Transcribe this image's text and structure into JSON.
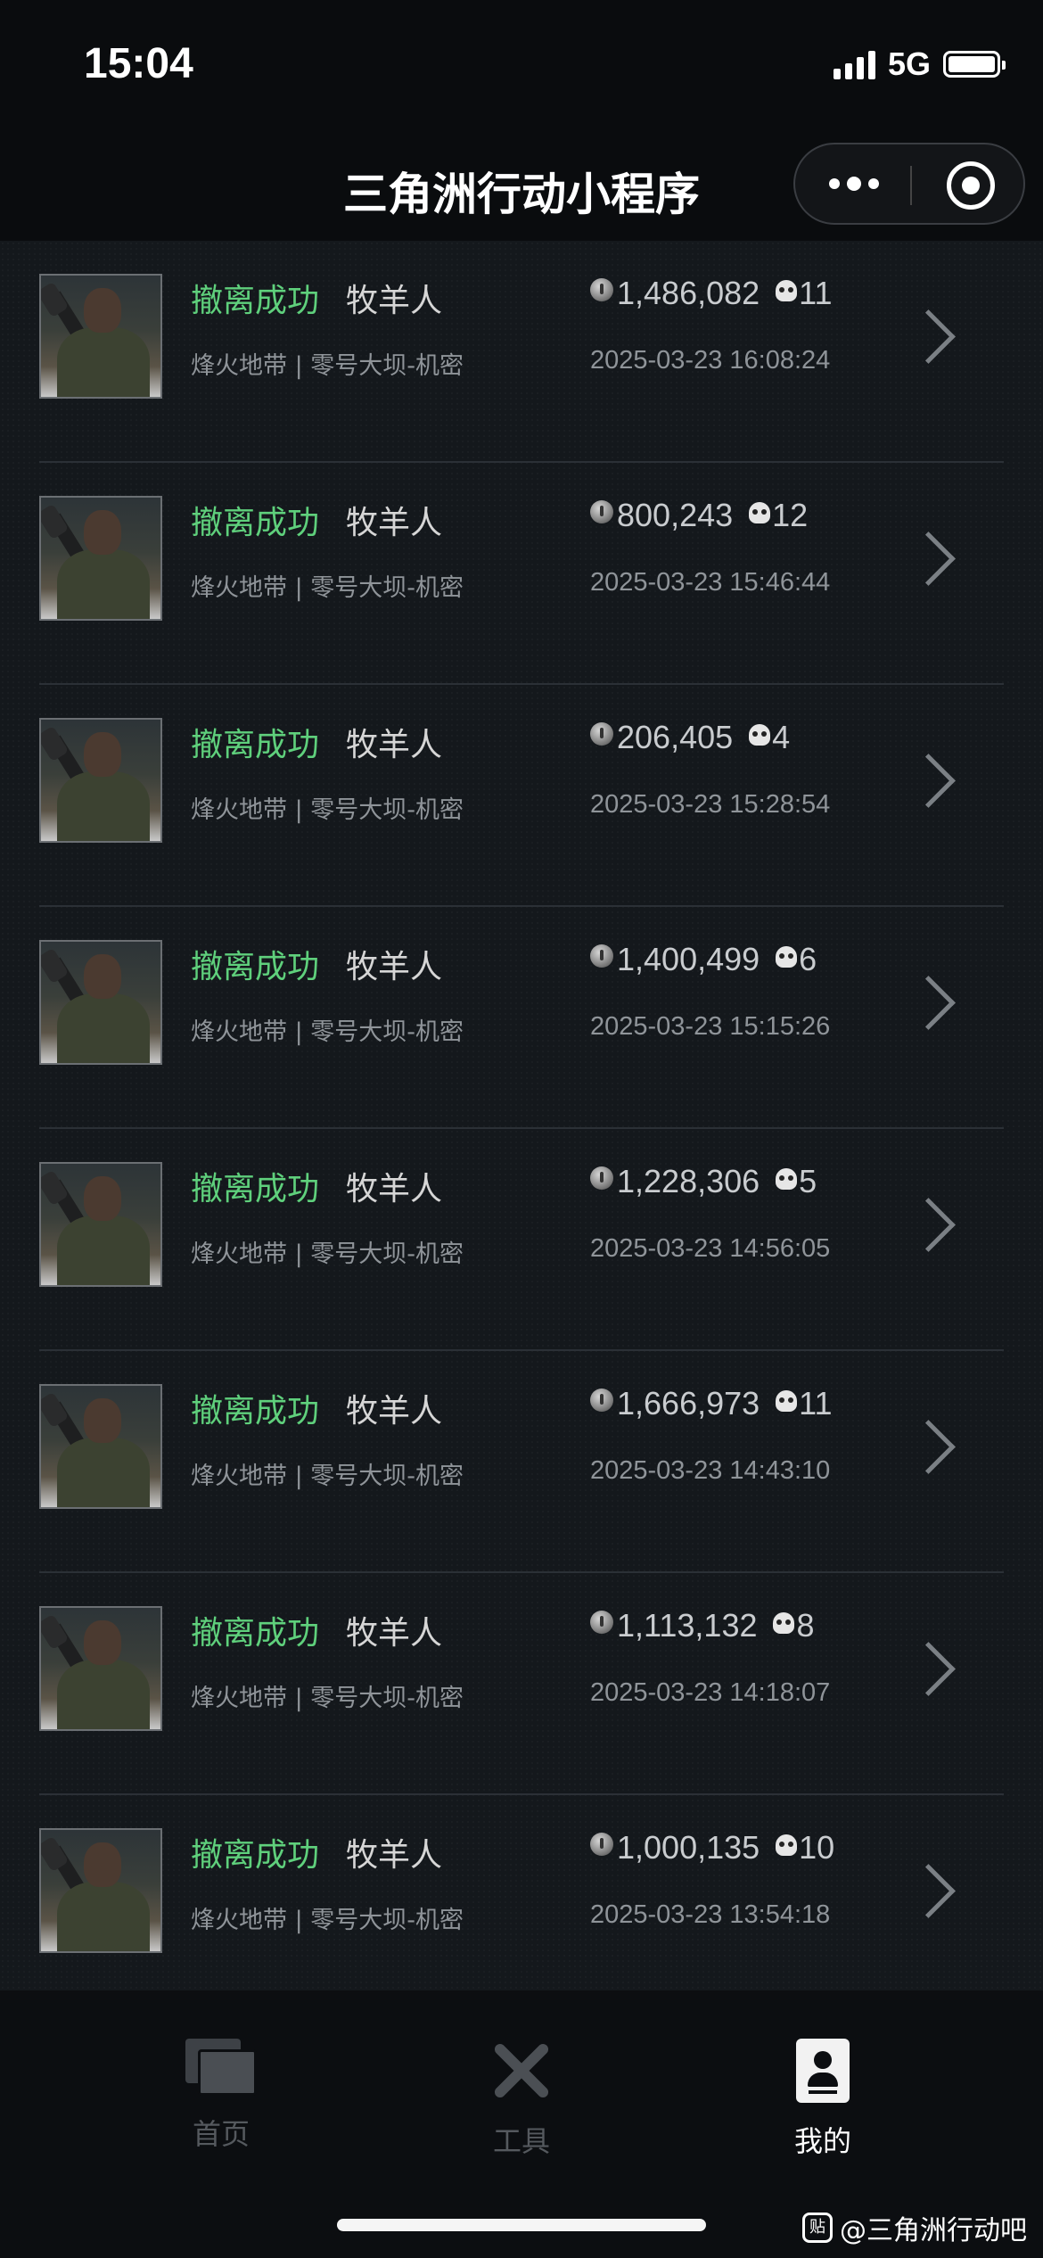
{
  "status_bar": {
    "time": "15:04",
    "network": "5G",
    "icons": [
      "signal-icon",
      "battery-icon"
    ]
  },
  "nav": {
    "title": "三角洲行动小程序",
    "capsule_icons": [
      "more-dots-icon",
      "close-target-icon"
    ]
  },
  "records": [
    {
      "status": "撤离成功",
      "role": "牧羊人",
      "value": "1,486,082",
      "kills": "11",
      "map": "烽火地带 | 零号大坝-机密",
      "time": "2025-03-23 16:08:24"
    },
    {
      "status": "撤离成功",
      "role": "牧羊人",
      "value": "800,243",
      "kills": "12",
      "map": "烽火地带 | 零号大坝-机密",
      "time": "2025-03-23 15:46:44"
    },
    {
      "status": "撤离成功",
      "role": "牧羊人",
      "value": "206,405",
      "kills": "4",
      "map": "烽火地带 | 零号大坝-机密",
      "time": "2025-03-23 15:28:54"
    },
    {
      "status": "撤离成功",
      "role": "牧羊人",
      "value": "1,400,499",
      "kills": "6",
      "map": "烽火地带 | 零号大坝-机密",
      "time": "2025-03-23 15:15:26"
    },
    {
      "status": "撤离成功",
      "role": "牧羊人",
      "value": "1,228,306",
      "kills": "5",
      "map": "烽火地带 | 零号大坝-机密",
      "time": "2025-03-23 14:56:05"
    },
    {
      "status": "撤离成功",
      "role": "牧羊人",
      "value": "1,666,973",
      "kills": "11",
      "map": "烽火地带 | 零号大坝-机密",
      "time": "2025-03-23 14:43:10"
    },
    {
      "status": "撤离成功",
      "role": "牧羊人",
      "value": "1,113,132",
      "kills": "8",
      "map": "烽火地带 | 零号大坝-机密",
      "time": "2025-03-23 14:18:07"
    },
    {
      "status": "撤离成功",
      "role": "牧羊人",
      "value": "1,000,135",
      "kills": "10",
      "map": "烽火地带 | 零号大坝-机密",
      "time": "2025-03-23 13:54:18"
    }
  ],
  "tabs": [
    {
      "label": "首页",
      "icon": "folder-icon",
      "active": false
    },
    {
      "label": "工具",
      "icon": "tools-icon",
      "active": false
    },
    {
      "label": "我的",
      "icon": "profile-icon",
      "active": true
    }
  ],
  "watermark": {
    "icon_text": "贴",
    "text": "@三角洲行动吧"
  },
  "colors": {
    "success": "#5fd07c",
    "background": "#14181c",
    "bar": "#0a0c0e"
  }
}
